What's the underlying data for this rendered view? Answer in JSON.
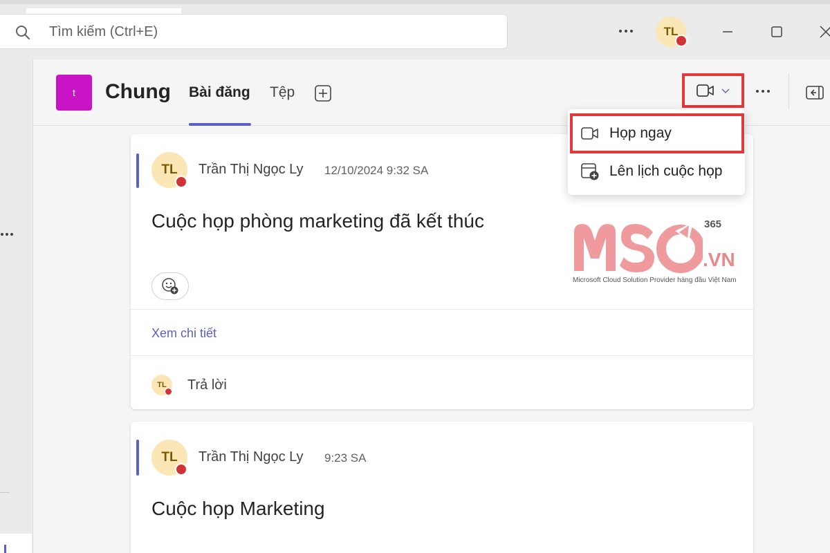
{
  "search": {
    "placeholder": "Tìm kiếm (Ctrl+E)"
  },
  "user": {
    "initials": "TL",
    "status_color": "#d13438"
  },
  "channel": {
    "team_initial": "t",
    "team_color": "#c914c6",
    "name": "Chung",
    "tabs": [
      {
        "label": "Bài đăng",
        "active": true
      },
      {
        "label": "Tệp",
        "active": false
      }
    ]
  },
  "meet_menu": {
    "items": [
      {
        "label": "Họp ngay",
        "icon": "video-camera-icon",
        "highlighted": true
      },
      {
        "label": "Lên lịch cuộc họp",
        "icon": "calendar-add-icon",
        "highlighted": false
      }
    ]
  },
  "posts": [
    {
      "author_initials": "TL",
      "author": "Trần Thị Ngọc Ly",
      "time": "12/10/2024 9:32 SA",
      "title": "Cuộc họp phòng marketing đã kết thúc",
      "see_more": "Xem chi tiết",
      "reply_initials": "TL",
      "reply_label": "Trả lời"
    },
    {
      "author_initials": "TL",
      "author": "Trần Thị Ngọc Ly",
      "time": "9:23 SA",
      "title": "Cuộc họp Marketing"
    }
  ],
  "watermark": {
    "brand": "MSO",
    "superscript": "365",
    "domain": ".VN",
    "tagline": "Microsoft Cloud Solution Provider hàng đầu Việt Nam"
  },
  "colors": {
    "accent": "#5b5fc7",
    "highlight_border": "#e03a3e",
    "presence_busy": "#d13438"
  }
}
